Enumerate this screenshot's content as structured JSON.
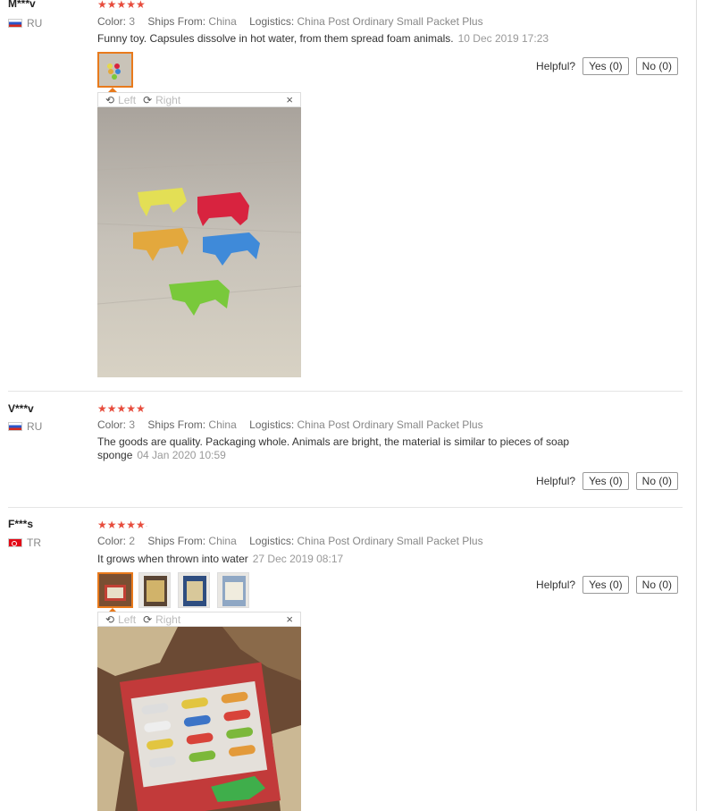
{
  "labels": {
    "color": "Color:",
    "ships_from": "Ships From:",
    "logistics": "Logistics:",
    "helpful": "Helpful?",
    "rotate_left": "Left",
    "rotate_right": "Right",
    "close": "×"
  },
  "reviews": [
    {
      "user": "M***v",
      "country": "RU",
      "stars": "★★★★★",
      "color": "3",
      "ships_from": "China",
      "logistics": "China Post Ordinary Small Packet Plus",
      "text": "Funny toy. Capsules dissolve in hot water, from them spread foam animals.",
      "date": "10 Dec 2019 17:23",
      "yes": "Yes (0)",
      "no": "No (0)"
    },
    {
      "user": "V***v",
      "country": "RU",
      "stars": "★★★★★",
      "color": "3",
      "ships_from": "China",
      "logistics": "China Post Ordinary Small Packet Plus",
      "text": "The goods are quality. Packaging whole. Animals are bright, the material is similar to pieces of soap sponge",
      "date": "04 Jan 2020 10:59",
      "yes": "Yes (0)",
      "no": "No (0)"
    },
    {
      "user": "F***s",
      "country": "TR",
      "stars": "★★★★★",
      "color": "2",
      "ships_from": "China",
      "logistics": "China Post Ordinary Small Packet Plus",
      "text": "It grows when thrown into water",
      "date": "27 Dec 2019 08:17",
      "yes": "Yes (0)",
      "no": "No (0)"
    }
  ],
  "icons": {
    "rotate_left": "rotate-left-icon",
    "rotate_right": "rotate-right-icon",
    "close": "close-icon"
  },
  "colors": {
    "star": "#e74c3c",
    "selected_thumb": "#e87a1c"
  }
}
